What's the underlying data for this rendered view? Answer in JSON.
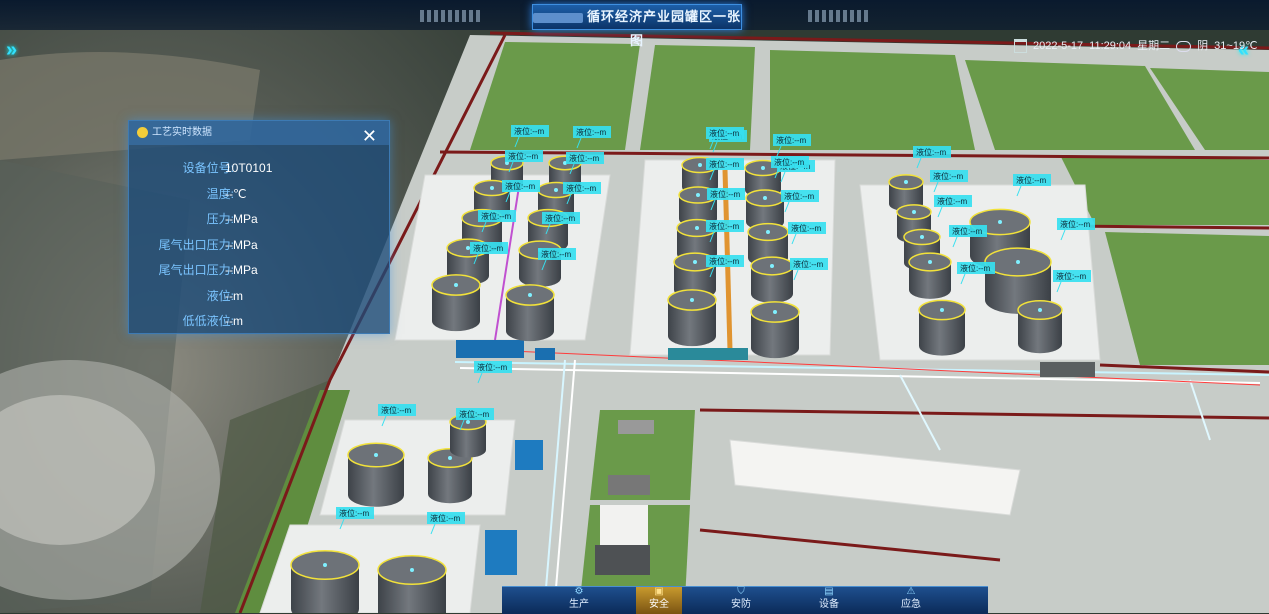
{
  "app": {
    "title": "循环经济产业园罐区一张图"
  },
  "datetime": {
    "date": "2022-5-17",
    "time": "11:29:04",
    "weekday": "星期二",
    "weather": "阴",
    "temperature": "31~19℃"
  },
  "panel": {
    "title": "工艺实时数据",
    "close": "✕",
    "rows": [
      {
        "label": "设备位号:",
        "value": "10T0101"
      },
      {
        "label": "温度:",
        "value": "--℃"
      },
      {
        "label": "压力:",
        "value": "--MPa"
      },
      {
        "label": "尾气出口压力:",
        "value": "--MPa"
      },
      {
        "label": "尾气出口压力:",
        "value": "--MPa"
      },
      {
        "label": "液位:",
        "value": "--m"
      },
      {
        "label": "低低液位:",
        "value": "--m"
      }
    ]
  },
  "tank_labels": [
    "液位:--m",
    "液位:--m",
    "液位:--m",
    "液位:--m",
    "液位:--m",
    "液位:--m",
    "液位:--m",
    "液位:--m",
    "液位:--m",
    "液位:--m",
    "液位:--m",
    "液位:--m",
    "液位:--m",
    "液位:--m",
    "液位:--m",
    "液位:--m",
    "液位:--m",
    "液位:--m",
    "液位:--m",
    "液位:--m",
    "液位:--m",
    "液位:--m",
    "液位:--m",
    "液位:--m",
    "液位:--m",
    "液位:--m",
    "液位:--m",
    "液位:--m",
    "液位:--m",
    "液位:--m",
    "液位:--m",
    "液位:--m",
    "液位:--m",
    "液位:--m",
    "液位:--m"
  ],
  "nav": {
    "items": [
      {
        "label": "生产",
        "icon": "production-icon",
        "active": false
      },
      {
        "label": "安全",
        "icon": "safety-icon",
        "active": true
      },
      {
        "label": "安防",
        "icon": "security-icon",
        "active": false
      },
      {
        "label": "设备",
        "icon": "equipment-icon",
        "active": false
      },
      {
        "label": "应急",
        "icon": "emergency-icon",
        "active": false
      }
    ]
  },
  "colors": {
    "grass": "#6a9a4a",
    "ground": "#c7ccc8",
    "road": "#b7bdb9",
    "wall": "#7a1a1a",
    "tank": "#5b6066",
    "label_bg": "#36e0f0",
    "accent": "#33e0ff"
  }
}
